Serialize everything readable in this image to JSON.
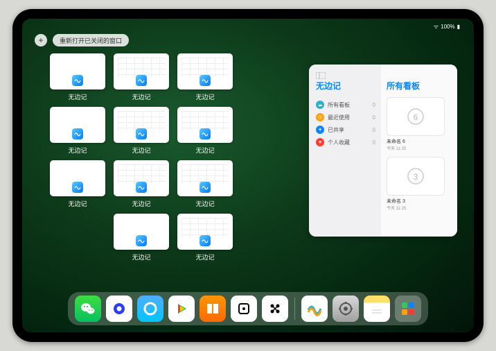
{
  "status": {
    "battery": "100%"
  },
  "topbar": {
    "add": "+",
    "reopen": "重新打开已关闭的窗口"
  },
  "window_label": "无边记",
  "windows": [
    {
      "variant": "blank"
    },
    {
      "variant": "grid"
    },
    {
      "variant": "grid"
    },
    null,
    {
      "variant": "blank"
    },
    {
      "variant": "grid"
    },
    {
      "variant": "grid"
    },
    null,
    {
      "variant": "blank"
    },
    {
      "variant": "grid"
    },
    {
      "variant": "grid"
    },
    null,
    null,
    {
      "variant": "blank"
    },
    {
      "variant": "grid"
    },
    null
  ],
  "panel": {
    "left_title": "无边记",
    "right_title": "所有看板",
    "sidebar": [
      {
        "icon_color": "#30b0c7",
        "glyph": "☁",
        "label": "所有看板",
        "count": 0
      },
      {
        "icon_color": "#ff9f0a",
        "glyph": "◷",
        "label": "最近使用",
        "count": 0
      },
      {
        "icon_color": "#0a84ff",
        "glyph": "✦",
        "label": "已共享",
        "count": 0
      },
      {
        "icon_color": "#ff3b30",
        "glyph": "♥",
        "label": "个人收藏",
        "count": 0
      }
    ],
    "boards": [
      {
        "name": "未命名 6",
        "date": "今天 11:25",
        "digit": "6"
      },
      {
        "name": "未命名 3",
        "date": "今天 11:25",
        "digit": "3"
      }
    ]
  },
  "dock": [
    {
      "name": "wechat",
      "bg": "linear-gradient(#3cdd40,#07c160)",
      "fg": "#fff"
    },
    {
      "name": "quark",
      "bg": "#fff",
      "fg": "#2b3cff"
    },
    {
      "name": "qq-browser",
      "bg": "linear-gradient(#4facfe,#00c6ff)",
      "fg": "#fff"
    },
    {
      "name": "video-app",
      "bg": "#fff",
      "fg": ""
    },
    {
      "name": "books",
      "bg": "linear-gradient(#ff9500,#ff6a00)",
      "fg": "#fff"
    },
    {
      "name": "dice",
      "bg": "#fff",
      "fg": "#000"
    },
    {
      "name": "hex-app",
      "bg": "#fff",
      "fg": "#000"
    },
    {
      "sep": true
    },
    {
      "name": "freeform",
      "bg": "#fff",
      "fg": ""
    },
    {
      "name": "settings",
      "bg": "linear-gradient(#d8d8d8,#a0a0a0)",
      "fg": "#555"
    },
    {
      "name": "notes",
      "bg": "linear-gradient(#ffe066 28%,#fff 28%)",
      "fg": ""
    },
    {
      "name": "app-library",
      "bg": "rgba(255,255,255,.25)",
      "fg": ""
    }
  ]
}
